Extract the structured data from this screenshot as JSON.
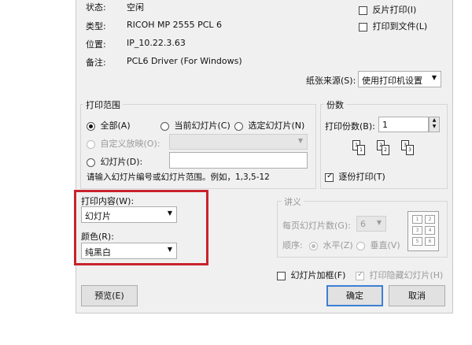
{
  "printer_info": {
    "status_label": "状态:",
    "status_value": "空闲",
    "type_label": "类型:",
    "type_value": "RICOH MP 2555 PCL 6",
    "location_label": "位置:",
    "location_value": "IP_10.22.3.63",
    "comment_label": "备注:",
    "comment_value": "PCL6 Driver (For Windows)"
  },
  "options": {
    "reverse_print": "反片打印(I)",
    "print_to_file": "打印到文件(L)"
  },
  "paper_source": {
    "label": "纸张来源(S):",
    "value": "使用打印机设置"
  },
  "range": {
    "title": "打印范围",
    "all": "全部(A)",
    "current": "当前幻灯片(C)",
    "selection": "选定幻灯片(N)",
    "custom": "自定义放映(O):",
    "slides": "幻灯片(D):",
    "slides_value": "",
    "hint": "请输入幻灯片编号或幻灯片范围。例如，1,3,5-12"
  },
  "copies": {
    "title": "份数",
    "count_label": "打印份数(B):",
    "count_value": "1",
    "collate": "逐份打印(T)",
    "stack_labels": [
      "1",
      "1",
      "2",
      "2",
      "3",
      "3"
    ]
  },
  "content": {
    "label": "打印内容(W):",
    "value": "幻灯片"
  },
  "color": {
    "label": "颜色(R):",
    "value": "纯黑白"
  },
  "handouts": {
    "title": "讲义",
    "per_page_label": "每页幻灯片数(G):",
    "per_page_value": "6",
    "order_label": "顺序:",
    "horizontal": "水平(Z)",
    "vertical": "垂直(V)",
    "grid_numbers": [
      "1",
      "2",
      "3",
      "4",
      "5",
      "6"
    ]
  },
  "frame": "幻灯片加框(F)",
  "print_hidden": "打印隐藏幻灯片(H)",
  "buttons": {
    "preview": "预览(E)",
    "ok": "确定",
    "cancel": "取消"
  },
  "highlight_color": "#c8232c"
}
